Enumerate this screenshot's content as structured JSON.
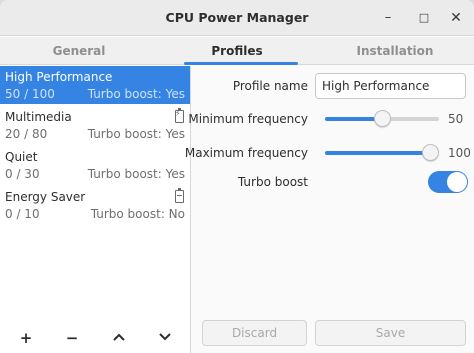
{
  "window": {
    "title": "CPU Power Manager"
  },
  "controls": {
    "minimize": "–",
    "maximize": "□",
    "close": "✕"
  },
  "tabs": [
    {
      "label": "General"
    },
    {
      "label": "Profiles"
    },
    {
      "label": "Installation"
    }
  ],
  "profiles": [
    {
      "name": "High Performance",
      "range": "50 / 100",
      "turbo": "Turbo boost: Yes",
      "selected": true,
      "icon": ""
    },
    {
      "name": "Multimedia",
      "range": "20 / 80",
      "turbo": "Turbo boost: Yes",
      "selected": false,
      "icon": "battery-charging-icon"
    },
    {
      "name": "Quiet",
      "range": "0 / 30",
      "turbo": "Turbo boost: Yes",
      "selected": false,
      "icon": ""
    },
    {
      "name": "Energy Saver",
      "range": "0 / 10",
      "turbo": "Turbo boost: No",
      "selected": false,
      "icon": "battery-icon"
    }
  ],
  "toolbar": {
    "add": "+",
    "remove": "−"
  },
  "form": {
    "profile_name_label": "Profile name",
    "profile_name_value": "High Performance",
    "min_freq_label": "Minimum frequency",
    "min_freq_value": "50",
    "min_freq_level": 50,
    "max_freq_label": "Maximum frequency",
    "max_freq_value": "100",
    "max_freq_level": 100,
    "turbo_label": "Turbo boost",
    "turbo_on": true
  },
  "actions": {
    "discard": "Discard",
    "save": "Save"
  },
  "colors": {
    "accent": "#3584e4"
  }
}
